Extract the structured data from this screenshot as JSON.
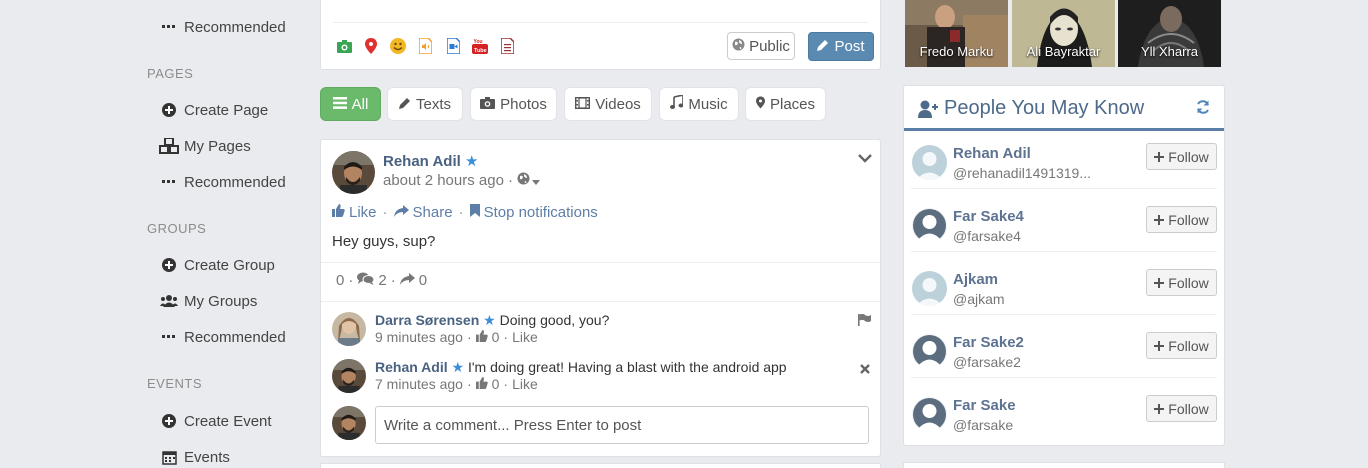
{
  "sidebar": {
    "recommended_top": "Recommended",
    "pages_heading": "PAGES",
    "create_page": "Create Page",
    "my_pages": "My Pages",
    "pages_recommended": "Recommended",
    "groups_heading": "GROUPS",
    "create_group": "Create Group",
    "my_groups": "My Groups",
    "groups_recommended": "Recommended",
    "events_heading": "EVENTS",
    "create_event": "Create Event",
    "events": "Events"
  },
  "composer": {
    "public_label": "Public",
    "post_label": "Post"
  },
  "filters": {
    "all": "All",
    "texts": "Texts",
    "photos": "Photos",
    "videos": "Videos",
    "music": "Music",
    "places": "Places"
  },
  "post": {
    "author": "Rehan Adil",
    "time": "about 2 hours ago",
    "like": "Like",
    "share": "Share",
    "stop_notifications": "Stop notifications",
    "text": "Hey guys, sup?",
    "likes_count": "0",
    "comments_count": "2",
    "shares_count": "0",
    "comments": [
      {
        "author": "Darra Sørensen",
        "text": "Doing good, you?",
        "time": "9 minutes ago",
        "likes": "0",
        "like_label": "Like"
      },
      {
        "author": "Rehan Adil",
        "text": "I'm doing great! Having a blast with the android app",
        "time": "7 minutes ago",
        "likes": "0",
        "like_label": "Like"
      }
    ],
    "comment_placeholder": "Write a comment... Press Enter to post"
  },
  "photos": [
    {
      "caption": "Fredo Marku"
    },
    {
      "caption": "Ali Bayraktar"
    },
    {
      "caption": "Yll Xharra"
    }
  ],
  "pymk": {
    "title": "People You May Know",
    "follow_label": "Follow",
    "people": [
      {
        "name": "Rehan Adil",
        "handle": "@rehanadil1491319..."
      },
      {
        "name": "Far Sake4",
        "handle": "@farsake4"
      },
      {
        "name": "Ajkam",
        "handle": "@ajkam"
      },
      {
        "name": "Far Sake2",
        "handle": "@farsake2"
      },
      {
        "name": "Far Sake",
        "handle": "@farsake"
      }
    ]
  },
  "colors": {
    "accent_blue": "#5a8ab1",
    "active_tab": "#6bb96a",
    "link": "#5d7ea6"
  }
}
